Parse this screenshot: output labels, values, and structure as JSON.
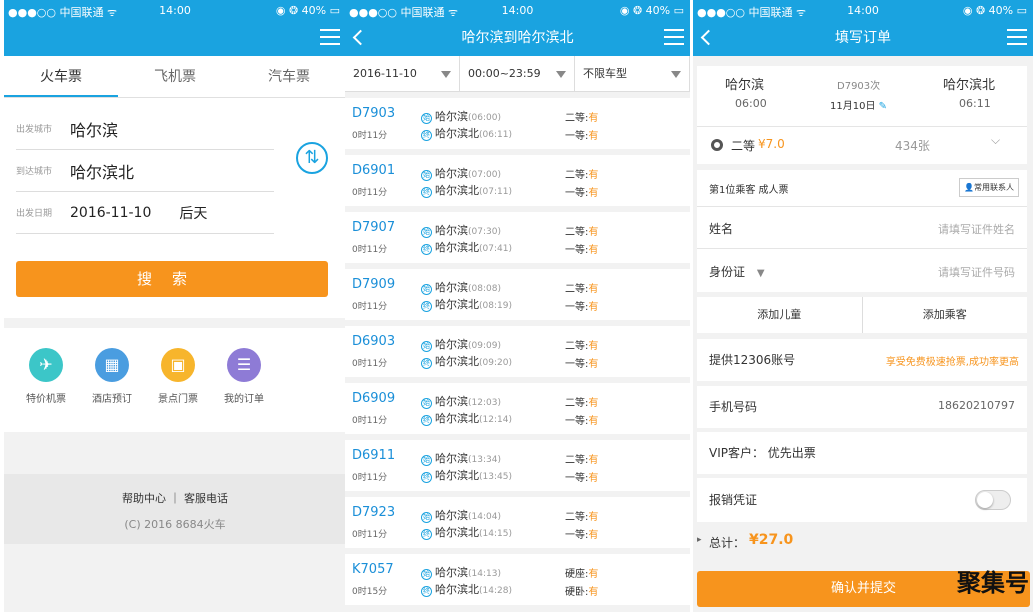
{
  "status": {
    "carrier": "●●●○○ 中国联通 ᯤ",
    "time": "14:00",
    "battery": "◉ ❂ 40% ▭"
  },
  "p1": {
    "tabs": [
      "火车票",
      "飞机票",
      "汽车票"
    ],
    "from_label": "出发城市",
    "from": "哈尔滨",
    "to_label": "到达城市",
    "to": "哈尔滨北",
    "date_label": "出发日期",
    "date": "2016-11-10",
    "day": "后天",
    "search": "搜索",
    "quick": [
      {
        "label": "特价机票",
        "icon": "✈",
        "color": "#3cc6c8"
      },
      {
        "label": "酒店预订",
        "icon": "▦",
        "color": "#4a9de0"
      },
      {
        "label": "景点门票",
        "icon": "▣",
        "color": "#f7b52c"
      },
      {
        "label": "我的订单",
        "icon": "☰",
        "color": "#8e7bd6"
      }
    ],
    "footer_links": "帮助中心 ｜ 客服电话",
    "copyright": "(C) 2016 8684火车"
  },
  "p2": {
    "title": "哈尔滨到哈尔滨北",
    "filters": [
      "2016-11-10",
      "00:00~23:59",
      "不限车型"
    ],
    "trains": [
      {
        "no": "D7903",
        "dur": "0时11分",
        "from": "哈尔滨",
        "ft": "(06:00)",
        "to": "哈尔滨北",
        "tt": "(06:11)",
        "s1": "二等:",
        "v1": "有",
        "s2": "一等:",
        "v2": "有"
      },
      {
        "no": "D6901",
        "dur": "0时11分",
        "from": "哈尔滨",
        "ft": "(07:00)",
        "to": "哈尔滨北",
        "tt": "(07:11)",
        "s1": "二等:",
        "v1": "有",
        "s2": "一等:",
        "v2": "有"
      },
      {
        "no": "D7907",
        "dur": "0时11分",
        "from": "哈尔滨",
        "ft": "(07:30)",
        "to": "哈尔滨北",
        "tt": "(07:41)",
        "s1": "二等:",
        "v1": "有",
        "s2": "一等:",
        "v2": "有"
      },
      {
        "no": "D7909",
        "dur": "0时11分",
        "from": "哈尔滨",
        "ft": "(08:08)",
        "to": "哈尔滨北",
        "tt": "(08:19)",
        "s1": "二等:",
        "v1": "有",
        "s2": "一等:",
        "v2": "有"
      },
      {
        "no": "D6903",
        "dur": "0时11分",
        "from": "哈尔滨",
        "ft": "(09:09)",
        "to": "哈尔滨北",
        "tt": "(09:20)",
        "s1": "二等:",
        "v1": "有",
        "s2": "一等:",
        "v2": "有"
      },
      {
        "no": "D6909",
        "dur": "0时11分",
        "from": "哈尔滨",
        "ft": "(12:03)",
        "to": "哈尔滨北",
        "tt": "(12:14)",
        "s1": "二等:",
        "v1": "有",
        "s2": "一等:",
        "v2": "有"
      },
      {
        "no": "D6911",
        "dur": "0时11分",
        "from": "哈尔滨",
        "ft": "(13:34)",
        "to": "哈尔滨北",
        "tt": "(13:45)",
        "s1": "二等:",
        "v1": "有",
        "s2": "一等:",
        "v2": "有"
      },
      {
        "no": "D7923",
        "dur": "0时11分",
        "from": "哈尔滨",
        "ft": "(14:04)",
        "to": "哈尔滨北",
        "tt": "(14:15)",
        "s1": "二等:",
        "v1": "有",
        "s2": "一等:",
        "v2": "有"
      },
      {
        "no": "K7057",
        "dur": "0时15分",
        "from": "哈尔滨",
        "ft": "(14:13)",
        "to": "哈尔滨北",
        "tt": "(14:28)",
        "s1": "硬座:",
        "v1": "有",
        "s2": "硬卧:",
        "v2": "有"
      }
    ]
  },
  "p3": {
    "title": "填写订单",
    "from": "哈尔滨",
    "dep": "06:00",
    "train": "D7903次",
    "date": "11月10日",
    "to": "哈尔滨北",
    "arr": "06:11",
    "seat": "二等",
    "price": "¥7.0",
    "tickets": "434张",
    "passenger": "第1位乘客 成人票",
    "contacts": "常用联系人",
    "name_label": "姓名",
    "name_ph": "请填写证件姓名",
    "id_label": "身份证",
    "id_ph": "请填写证件号码",
    "add_child": "添加儿童",
    "add_pass": "添加乘客",
    "acct_label": "提供12306账号",
    "acct_hint": "享受免费极速抢票,成功率更高",
    "phone_label": "手机号码",
    "phone": "18620210797",
    "vip": "VIP客户：  优先出票",
    "receipt": "报销凭证",
    "total_label": "总计：",
    "total": "¥27.0",
    "submit": "确认并提交"
  },
  "watermark": "聚集号"
}
